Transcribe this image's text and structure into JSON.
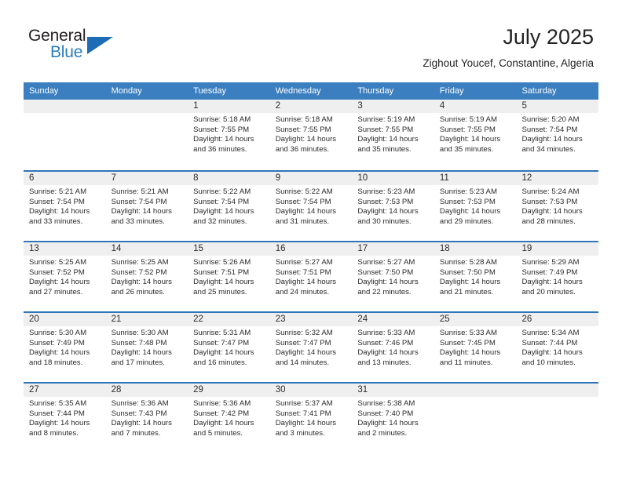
{
  "brand": {
    "name_part1": "General",
    "name_part2": "Blue",
    "triangle_icon": "triangle-icon",
    "accent_color": "#2b7cc0"
  },
  "header": {
    "month_title": "July 2025",
    "location": "Zighout Youcef, Constantine, Algeria"
  },
  "theme": {
    "header_blue": "#3b7fc0",
    "row_divider_blue": "#2f76b8",
    "day_band_gray": "#efefef",
    "text_color": "#2b2b2b"
  },
  "weekdays": [
    "Sunday",
    "Monday",
    "Tuesday",
    "Wednesday",
    "Thursday",
    "Friday",
    "Saturday"
  ],
  "weeks": [
    [
      {
        "day": "",
        "empty": true,
        "sunrise": "",
        "sunset": "",
        "daylight_line1": "",
        "daylight_line2": ""
      },
      {
        "day": "",
        "empty": true,
        "sunrise": "",
        "sunset": "",
        "daylight_line1": "",
        "daylight_line2": ""
      },
      {
        "day": "1",
        "sunrise": "Sunrise: 5:18 AM",
        "sunset": "Sunset: 7:55 PM",
        "daylight_line1": "Daylight: 14 hours",
        "daylight_line2": "and 36 minutes."
      },
      {
        "day": "2",
        "sunrise": "Sunrise: 5:18 AM",
        "sunset": "Sunset: 7:55 PM",
        "daylight_line1": "Daylight: 14 hours",
        "daylight_line2": "and 36 minutes."
      },
      {
        "day": "3",
        "sunrise": "Sunrise: 5:19 AM",
        "sunset": "Sunset: 7:55 PM",
        "daylight_line1": "Daylight: 14 hours",
        "daylight_line2": "and 35 minutes."
      },
      {
        "day": "4",
        "sunrise": "Sunrise: 5:19 AM",
        "sunset": "Sunset: 7:55 PM",
        "daylight_line1": "Daylight: 14 hours",
        "daylight_line2": "and 35 minutes."
      },
      {
        "day": "5",
        "sunrise": "Sunrise: 5:20 AM",
        "sunset": "Sunset: 7:54 PM",
        "daylight_line1": "Daylight: 14 hours",
        "daylight_line2": "and 34 minutes."
      }
    ],
    [
      {
        "day": "6",
        "sunrise": "Sunrise: 5:21 AM",
        "sunset": "Sunset: 7:54 PM",
        "daylight_line1": "Daylight: 14 hours",
        "daylight_line2": "and 33 minutes."
      },
      {
        "day": "7",
        "sunrise": "Sunrise: 5:21 AM",
        "sunset": "Sunset: 7:54 PM",
        "daylight_line1": "Daylight: 14 hours",
        "daylight_line2": "and 33 minutes."
      },
      {
        "day": "8",
        "sunrise": "Sunrise: 5:22 AM",
        "sunset": "Sunset: 7:54 PM",
        "daylight_line1": "Daylight: 14 hours",
        "daylight_line2": "and 32 minutes."
      },
      {
        "day": "9",
        "sunrise": "Sunrise: 5:22 AM",
        "sunset": "Sunset: 7:54 PM",
        "daylight_line1": "Daylight: 14 hours",
        "daylight_line2": "and 31 minutes."
      },
      {
        "day": "10",
        "sunrise": "Sunrise: 5:23 AM",
        "sunset": "Sunset: 7:53 PM",
        "daylight_line1": "Daylight: 14 hours",
        "daylight_line2": "and 30 minutes."
      },
      {
        "day": "11",
        "sunrise": "Sunrise: 5:23 AM",
        "sunset": "Sunset: 7:53 PM",
        "daylight_line1": "Daylight: 14 hours",
        "daylight_line2": "and 29 minutes."
      },
      {
        "day": "12",
        "sunrise": "Sunrise: 5:24 AM",
        "sunset": "Sunset: 7:53 PM",
        "daylight_line1": "Daylight: 14 hours",
        "daylight_line2": "and 28 minutes."
      }
    ],
    [
      {
        "day": "13",
        "sunrise": "Sunrise: 5:25 AM",
        "sunset": "Sunset: 7:52 PM",
        "daylight_line1": "Daylight: 14 hours",
        "daylight_line2": "and 27 minutes."
      },
      {
        "day": "14",
        "sunrise": "Sunrise: 5:25 AM",
        "sunset": "Sunset: 7:52 PM",
        "daylight_line1": "Daylight: 14 hours",
        "daylight_line2": "and 26 minutes."
      },
      {
        "day": "15",
        "sunrise": "Sunrise: 5:26 AM",
        "sunset": "Sunset: 7:51 PM",
        "daylight_line1": "Daylight: 14 hours",
        "daylight_line2": "and 25 minutes."
      },
      {
        "day": "16",
        "sunrise": "Sunrise: 5:27 AM",
        "sunset": "Sunset: 7:51 PM",
        "daylight_line1": "Daylight: 14 hours",
        "daylight_line2": "and 24 minutes."
      },
      {
        "day": "17",
        "sunrise": "Sunrise: 5:27 AM",
        "sunset": "Sunset: 7:50 PM",
        "daylight_line1": "Daylight: 14 hours",
        "daylight_line2": "and 22 minutes."
      },
      {
        "day": "18",
        "sunrise": "Sunrise: 5:28 AM",
        "sunset": "Sunset: 7:50 PM",
        "daylight_line1": "Daylight: 14 hours",
        "daylight_line2": "and 21 minutes."
      },
      {
        "day": "19",
        "sunrise": "Sunrise: 5:29 AM",
        "sunset": "Sunset: 7:49 PM",
        "daylight_line1": "Daylight: 14 hours",
        "daylight_line2": "and 20 minutes."
      }
    ],
    [
      {
        "day": "20",
        "sunrise": "Sunrise: 5:30 AM",
        "sunset": "Sunset: 7:49 PM",
        "daylight_line1": "Daylight: 14 hours",
        "daylight_line2": "and 18 minutes."
      },
      {
        "day": "21",
        "sunrise": "Sunrise: 5:30 AM",
        "sunset": "Sunset: 7:48 PM",
        "daylight_line1": "Daylight: 14 hours",
        "daylight_line2": "and 17 minutes."
      },
      {
        "day": "22",
        "sunrise": "Sunrise: 5:31 AM",
        "sunset": "Sunset: 7:47 PM",
        "daylight_line1": "Daylight: 14 hours",
        "daylight_line2": "and 16 minutes."
      },
      {
        "day": "23",
        "sunrise": "Sunrise: 5:32 AM",
        "sunset": "Sunset: 7:47 PM",
        "daylight_line1": "Daylight: 14 hours",
        "daylight_line2": "and 14 minutes."
      },
      {
        "day": "24",
        "sunrise": "Sunrise: 5:33 AM",
        "sunset": "Sunset: 7:46 PM",
        "daylight_line1": "Daylight: 14 hours",
        "daylight_line2": "and 13 minutes."
      },
      {
        "day": "25",
        "sunrise": "Sunrise: 5:33 AM",
        "sunset": "Sunset: 7:45 PM",
        "daylight_line1": "Daylight: 14 hours",
        "daylight_line2": "and 11 minutes."
      },
      {
        "day": "26",
        "sunrise": "Sunrise: 5:34 AM",
        "sunset": "Sunset: 7:44 PM",
        "daylight_line1": "Daylight: 14 hours",
        "daylight_line2": "and 10 minutes."
      }
    ],
    [
      {
        "day": "27",
        "sunrise": "Sunrise: 5:35 AM",
        "sunset": "Sunset: 7:44 PM",
        "daylight_line1": "Daylight: 14 hours",
        "daylight_line2": "and 8 minutes."
      },
      {
        "day": "28",
        "sunrise": "Sunrise: 5:36 AM",
        "sunset": "Sunset: 7:43 PM",
        "daylight_line1": "Daylight: 14 hours",
        "daylight_line2": "and 7 minutes."
      },
      {
        "day": "29",
        "sunrise": "Sunrise: 5:36 AM",
        "sunset": "Sunset: 7:42 PM",
        "daylight_line1": "Daylight: 14 hours",
        "daylight_line2": "and 5 minutes."
      },
      {
        "day": "30",
        "sunrise": "Sunrise: 5:37 AM",
        "sunset": "Sunset: 7:41 PM",
        "daylight_line1": "Daylight: 14 hours",
        "daylight_line2": "and 3 minutes."
      },
      {
        "day": "31",
        "sunrise": "Sunrise: 5:38 AM",
        "sunset": "Sunset: 7:40 PM",
        "daylight_line1": "Daylight: 14 hours",
        "daylight_line2": "and 2 minutes."
      },
      {
        "day": "",
        "empty": true,
        "sunrise": "",
        "sunset": "",
        "daylight_line1": "",
        "daylight_line2": ""
      },
      {
        "day": "",
        "empty": true,
        "sunrise": "",
        "sunset": "",
        "daylight_line1": "",
        "daylight_line2": ""
      }
    ]
  ]
}
